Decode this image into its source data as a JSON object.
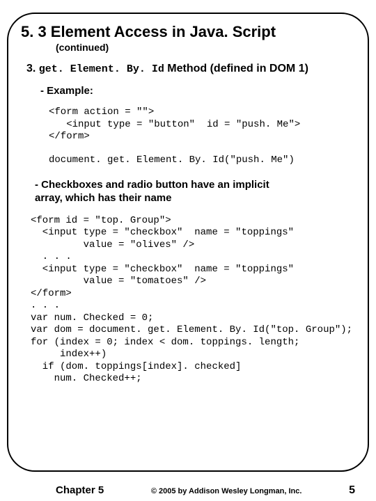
{
  "title": "5. 3 Element Access in Java. Script",
  "subtitle": "(continued)",
  "heading_num": "3. ",
  "heading_method": "get. Element. By. Id",
  "heading_rest": " Method (defined in DOM 1)",
  "example_label": "- Example:",
  "code1": "<form action = \"\">\n   <input type = \"button\"  id = \"push. Me\">\n</form>",
  "code1b": "document. get. Element. By. Id(\"push. Me\")",
  "point": "- Checkboxes and radio button have an implicit\n   array, which has their name",
  "code2": "<form id = \"top. Group\">\n  <input type = \"checkbox\"  name = \"toppings\"\n         value = \"olives\" />\n  . . .\n  <input type = \"checkbox\"  name = \"toppings\"\n         value = \"tomatoes\" />\n</form>\n. . .\nvar num. Checked = 0;\nvar dom = document. get. Element. By. Id(\"top. Group\");\nfor (index = 0; index < dom. toppings. length;\n     index++)\n  if (dom. toppings[index]. checked]\n    num. Checked++;",
  "chapter": "Chapter 5",
  "copyright": "© 2005 by Addison Wesley Longman, Inc.",
  "pagenum": "5"
}
